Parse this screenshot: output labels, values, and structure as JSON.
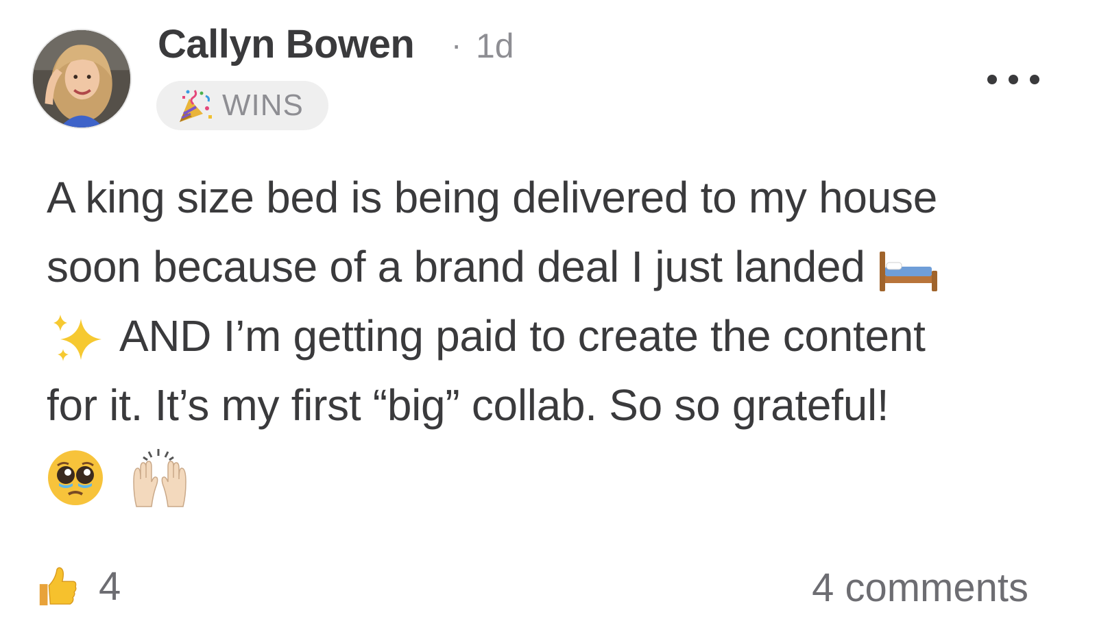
{
  "post": {
    "author": {
      "name": "Callyn Bowen",
      "avatar_icon": "user-avatar-photo"
    },
    "separator": "·",
    "time_ago": "1d",
    "category": {
      "icon": "party-popper-icon",
      "label": "WINS"
    },
    "more_icon": "ellipsis-icon",
    "body": {
      "line1": "A king size bed is being delivered to my house",
      "line2": "soon because of a brand deal I just landed",
      "line2_emoji": "bed-emoji",
      "line3_emoji": "sparkles-emoji",
      "line3": "AND I’m getting paid to create the content",
      "line4": "for it. It’s my first “big” collab. So so grateful!",
      "line5_emojis": [
        "pleading-face-emoji",
        "raising-hands-emoji"
      ]
    },
    "footer": {
      "like_icon": "thumbs-up-icon",
      "like_count": "4",
      "comments_label": "4 comments"
    }
  }
}
